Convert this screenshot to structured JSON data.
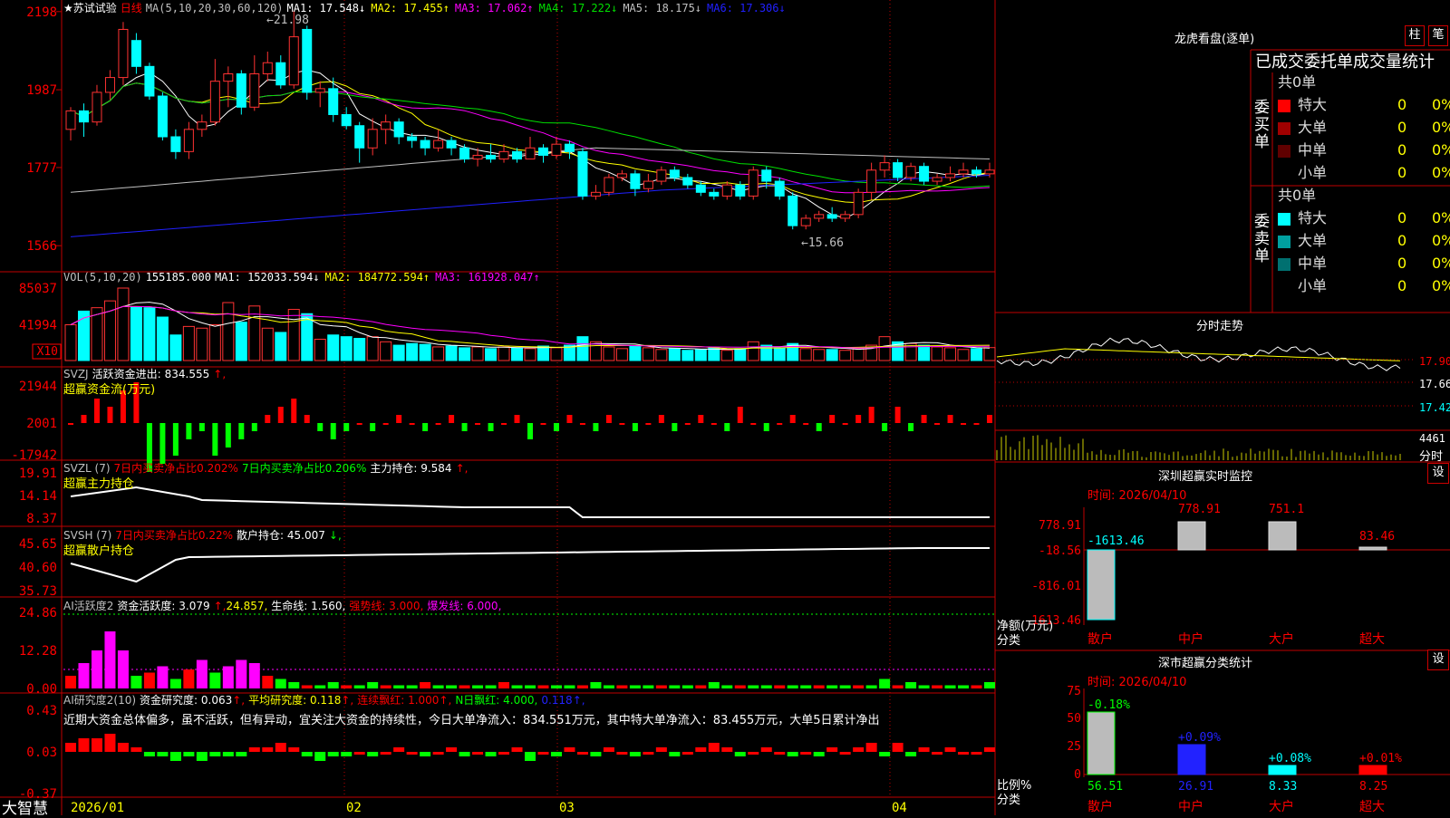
{
  "app": {
    "brand": "大智慧",
    "stock_name": "苏试试验",
    "period": "日线",
    "star": "★"
  },
  "colors": {
    "up": "#ff3232",
    "down": "#00ffff",
    "ma1": "#ffffff",
    "ma2": "#ffff00",
    "ma3": "#ff00ff",
    "ma4": "#00e000",
    "ma5": "#c0c0c0",
    "ma6": "#2020ff",
    "grid": "#c00000"
  },
  "price_panel": {
    "ma_label": "MA(5,10,20,30,60,120)",
    "ma": [
      {
        "name": "MA1:",
        "value": "17.548",
        "arrow": "↓",
        "color": "#ffffff"
      },
      {
        "name": "MA2:",
        "value": "17.455",
        "arrow": "↑",
        "color": "#ffff00"
      },
      {
        "name": "MA3:",
        "value": "17.062",
        "arrow": "↑",
        "color": "#ff00ff"
      },
      {
        "name": "MA4:",
        "value": "17.222",
        "arrow": "↓",
        "color": "#00e000"
      },
      {
        "name": "MA5:",
        "value": "18.175",
        "arrow": "↓",
        "color": "#c0c0c0"
      },
      {
        "name": "MA6:",
        "value": "17.306",
        "arrow": "↓",
        "color": "#2020ff"
      }
    ],
    "y_ticks": [
      "2198",
      "1987",
      "1777",
      "1566"
    ],
    "high_label": "21.98",
    "low_label": "15.66"
  },
  "vol_panel": {
    "label": "VOL(5,10,20)",
    "value": "155185.000",
    "ma": [
      {
        "name": "MA1:",
        "value": "152033.594",
        "arrow": "↓",
        "color": "#ffffff"
      },
      {
        "name": "MA2:",
        "value": "184772.594",
        "arrow": "↑",
        "color": "#ffff00"
      },
      {
        "name": "MA3:",
        "value": "161928.047",
        "arrow": "↑",
        "color": "#ff00ff"
      }
    ],
    "y_ticks": [
      "85037",
      "41994"
    ],
    "unit": "X10"
  },
  "svzj_panel": {
    "label": "SVZJ",
    "desc": "活跃资金进出:",
    "value": "834.555",
    "arrow": "↑,",
    "sub": "超赢资金流(万元)",
    "y_ticks": [
      "21944",
      "2001",
      "-17942"
    ]
  },
  "svzl_panel": {
    "label": "SVZL (7)",
    "t1": "7日内买卖净占比0.202%",
    "t2": "7日内买卖净占比0.206%",
    "t3": "主力持仓: 9.584",
    "arrow": "↑,",
    "sub": "超赢主力持仓",
    "y_ticks": [
      "19.91",
      "14.14",
      "8.37"
    ]
  },
  "svsh_panel": {
    "label": "SVSH (7)",
    "t1": "7日内买卖净占比0.22%",
    "t2": "散户持仓: 45.007",
    "arrow": "↓,",
    "sub": "超赢散户持仓",
    "y_ticks": [
      "45.65",
      "40.60",
      "35.73"
    ]
  },
  "ai_active_panel": {
    "label": "AI活跃度2",
    "t1": "资金活跃度: 3.079",
    "t1_arrow": "↑,",
    "t2": "24.857,",
    "t3": "生命线: 1.560,",
    "t4": "强势线: 3.000,",
    "t5": "爆发线: 6.000,",
    "y_ticks": [
      "24.86",
      "12.28",
      "0.00"
    ]
  },
  "ai_research_panel": {
    "label": "AI研究度2(10)",
    "t1": "资金研究度: 0.063",
    "t1_arrow": "↑,",
    "t2": "平均研究度: 0.118",
    "t2_arrow": "↑,",
    "t3": "连续飘红: 1.000",
    "t3_arrow": "↑,",
    "t4": "N日飘红: 4.000,",
    "t5": "0.118",
    "t5_arrow": "↑,",
    "comment": "近期大资金总体偏多，虽不活跃，但有异动，宜关注大资金的持续性，今日大单净流入：834.551万元，其中特大单净流入：83.455万元，大单5日累计净出",
    "y_ticks": [
      "0.43",
      "0.03",
      "-0.37"
    ]
  },
  "x_axis": {
    "labels": [
      "2026/01",
      "02",
      "03",
      "04"
    ]
  },
  "right_top": {
    "title": "龙虎看盘(逐单)",
    "btn1": "柱",
    "btn2": "笔",
    "table_title": "已成交委托单成交量统计",
    "buy_label": "委买单",
    "sell_label": "委卖单",
    "buy_total": "共0单",
    "sell_total": "共0单",
    "buy_rows": [
      {
        "name": "特大",
        "count": "0",
        "pct": "0%",
        "color": "#ff0000"
      },
      {
        "name": "大单",
        "count": "0",
        "pct": "0%",
        "color": "#a00000"
      },
      {
        "name": "中单",
        "count": "0",
        "pct": "0%",
        "color": "#600000"
      },
      {
        "name": "小单",
        "count": "0",
        "pct": "0%",
        "color": ""
      }
    ],
    "sell_rows": [
      {
        "name": "特大",
        "count": "0",
        "pct": "0%",
        "color": "#00ffff"
      },
      {
        "name": "大单",
        "count": "0",
        "pct": "0%",
        "color": "#00a0a0"
      },
      {
        "name": "中单",
        "count": "0",
        "pct": "0%",
        "color": "#007070"
      },
      {
        "name": "小单",
        "count": "0",
        "pct": "0%",
        "color": ""
      }
    ]
  },
  "intraday": {
    "title": "分时走势",
    "y_ticks": [
      "17.90",
      "17.66",
      "17.42"
    ],
    "vol_value": "4461",
    "vol_label": "分时"
  },
  "monitor": {
    "title": "深圳超赢实时监控",
    "btn": "设",
    "time": "时间: 2026/04/10",
    "y_ticks": [
      "778.91",
      "-18.56",
      "-816.01",
      "-1613.46"
    ],
    "y_unit": "净额(万元)",
    "x_unit": "分类"
  },
  "classify": {
    "title": "深市超赢分类统计",
    "btn": "设",
    "time": "时间: 2026/04/10",
    "y_ticks": [
      "75",
      "50",
      "25",
      "0"
    ],
    "y_unit": "比例%",
    "x_unit": "分类"
  },
  "chart_data": [
    {
      "type": "candlestick",
      "title": "苏试试验 日线",
      "ylim": [
        15.2,
        22.0
      ],
      "x": [
        "2026/01",
        "02",
        "03",
        "04"
      ],
      "candles": [
        [
          18.8,
          19.3,
          18.5,
          19.4
        ],
        [
          19.3,
          19.0,
          18.6,
          19.5
        ],
        [
          19.0,
          19.8,
          18.9,
          20.0
        ],
        [
          19.8,
          20.2,
          19.6,
          20.4
        ],
        [
          20.2,
          21.5,
          20.0,
          21.7
        ],
        [
          21.2,
          20.5,
          20.3,
          21.4
        ],
        [
          20.5,
          19.7,
          19.6,
          20.6
        ],
        [
          19.7,
          18.6,
          18.5,
          19.8
        ],
        [
          18.6,
          18.2,
          18.0,
          18.8
        ],
        [
          18.2,
          18.8,
          18.0,
          19.0
        ],
        [
          18.8,
          19.0,
          18.6,
          19.2
        ],
        [
          19.0,
          20.1,
          18.9,
          20.7
        ],
        [
          20.1,
          20.3,
          19.4,
          20.5
        ],
        [
          20.3,
          19.4,
          19.2,
          20.4
        ],
        [
          19.4,
          20.3,
          19.3,
          20.8
        ],
        [
          20.3,
          20.6,
          20.1,
          20.9
        ],
        [
          20.6,
          20.0,
          19.9,
          20.8
        ],
        [
          20.0,
          21.3,
          19.9,
          22.0
        ],
        [
          21.5,
          19.8,
          19.6,
          21.6
        ],
        [
          19.8,
          19.9,
          19.4,
          20.1
        ],
        [
          19.9,
          19.2,
          19.0,
          20.2
        ],
        [
          19.2,
          18.9,
          18.8,
          19.4
        ],
        [
          18.9,
          18.3,
          17.9,
          19.0
        ],
        [
          18.3,
          18.8,
          18.1,
          19.1
        ],
        [
          18.8,
          19.0,
          18.4,
          19.2
        ],
        [
          19.0,
          18.6,
          18.4,
          19.1
        ],
        [
          18.6,
          18.5,
          18.3,
          18.7
        ],
        [
          18.5,
          18.3,
          18.1,
          18.6
        ],
        [
          18.3,
          18.5,
          18.2,
          18.8
        ],
        [
          18.5,
          18.3,
          18.1,
          18.6
        ],
        [
          18.3,
          18.0,
          17.9,
          18.4
        ],
        [
          18.0,
          18.1,
          17.8,
          18.3
        ],
        [
          18.1,
          18.0,
          17.9,
          18.4
        ],
        [
          18.0,
          18.2,
          17.9,
          18.4
        ],
        [
          18.2,
          18.0,
          17.9,
          18.3
        ],
        [
          18.0,
          18.3,
          18.0,
          18.6
        ],
        [
          18.3,
          18.1,
          17.9,
          18.4
        ],
        [
          18.1,
          18.4,
          18.0,
          18.6
        ],
        [
          18.4,
          18.2,
          18.0,
          18.5
        ],
        [
          18.2,
          17.0,
          16.9,
          18.3
        ],
        [
          17.0,
          17.1,
          16.9,
          17.3
        ],
        [
          17.1,
          17.5,
          17.0,
          17.6
        ],
        [
          17.5,
          17.6,
          17.4,
          17.7
        ],
        [
          17.6,
          17.2,
          17.0,
          17.7
        ],
        [
          17.2,
          17.4,
          17.1,
          17.6
        ],
        [
          17.4,
          17.7,
          17.3,
          17.8
        ],
        [
          17.7,
          17.5,
          17.4,
          17.8
        ],
        [
          17.5,
          17.3,
          17.2,
          17.6
        ],
        [
          17.3,
          17.1,
          17.0,
          17.4
        ],
        [
          17.1,
          17.0,
          16.9,
          17.2
        ],
        [
          17.0,
          17.3,
          16.9,
          17.4
        ],
        [
          17.3,
          17.0,
          16.9,
          17.4
        ],
        [
          17.0,
          17.7,
          16.9,
          17.8
        ],
        [
          17.7,
          17.4,
          17.2,
          17.8
        ],
        [
          17.4,
          17.0,
          16.9,
          17.5
        ],
        [
          17.0,
          16.2,
          16.1,
          17.1
        ],
        [
          16.2,
          16.4,
          16.1,
          16.5
        ],
        [
          16.4,
          16.5,
          16.3,
          16.6
        ],
        [
          16.5,
          16.4,
          16.3,
          16.7
        ],
        [
          16.4,
          16.5,
          16.3,
          16.6
        ],
        [
          16.5,
          17.1,
          16.4,
          17.2
        ],
        [
          17.1,
          17.7,
          16.9,
          17.9
        ],
        [
          17.7,
          17.9,
          17.5,
          18.1
        ],
        [
          17.9,
          17.5,
          17.4,
          18.0
        ],
        [
          17.5,
          17.8,
          17.4,
          17.9
        ],
        [
          17.8,
          17.4,
          17.3,
          17.9
        ],
        [
          17.4,
          17.5,
          17.3,
          17.6
        ],
        [
          17.5,
          17.6,
          17.4,
          17.8
        ],
        [
          17.6,
          17.7,
          17.5,
          17.9
        ],
        [
          17.7,
          17.6,
          17.5,
          17.8
        ],
        [
          17.6,
          17.7,
          17.5,
          17.9
        ]
      ]
    },
    {
      "type": "bar",
      "title": "VOL(5,10,20)",
      "ylim": [
        0,
        85037
      ],
      "values": [
        41994,
        58000,
        62000,
        70000,
        85037,
        63000,
        62000,
        51000,
        30000,
        40000,
        38000,
        42000,
        68000,
        45000,
        64000,
        38000,
        33000,
        60000,
        55000,
        25000,
        30000,
        28000,
        26000,
        28000,
        22000,
        18000,
        20000,
        19000,
        16000,
        17000,
        15000,
        16000,
        14000,
        16000,
        15000,
        14000,
        17000,
        15000,
        18000,
        28000,
        22000,
        16000,
        14000,
        17000,
        15000,
        13000,
        14000,
        12000,
        13000,
        15000,
        12000,
        14000,
        22000,
        18000,
        15000,
        20000,
        14000,
        13000,
        13000,
        12000,
        14000,
        18000,
        28000,
        22000,
        20000,
        18000,
        16000,
        15000,
        13000,
        14000,
        15185
      ]
    }
  ]
}
